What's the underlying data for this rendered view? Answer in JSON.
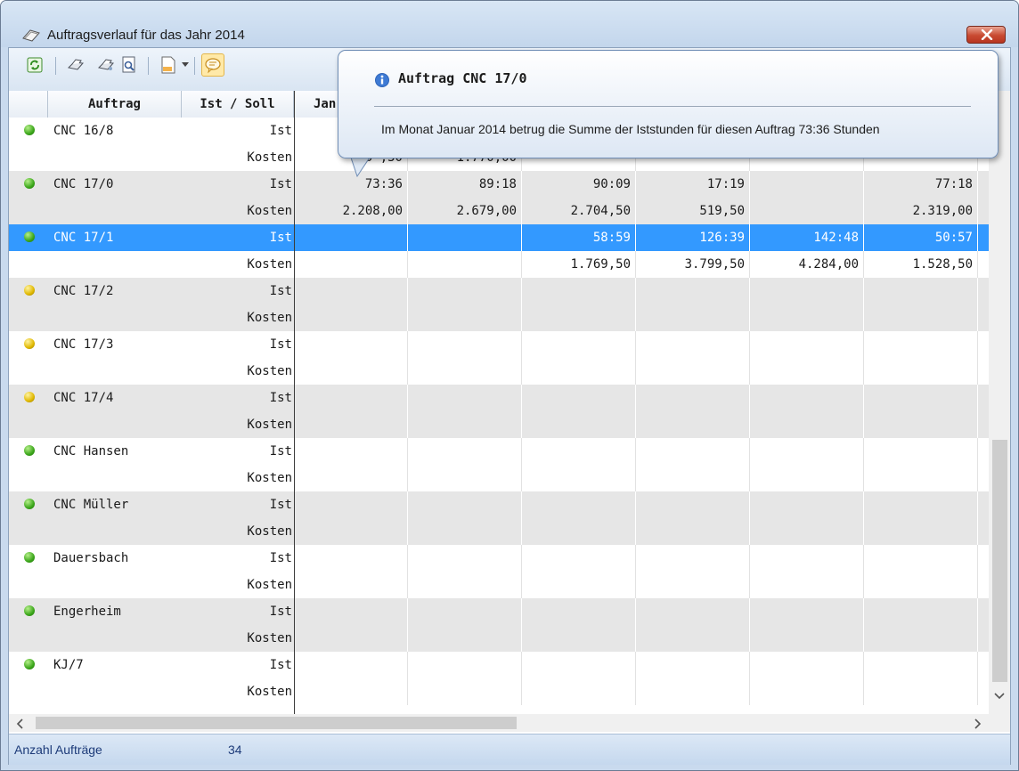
{
  "window": {
    "title": "Auftragsverlauf für das Jahr 2014"
  },
  "grid": {
    "headers": {
      "order": "Auftrag",
      "type": "Ist / Soll",
      "month1": "Jan"
    },
    "rows": [
      {
        "order": "CNC 16/8",
        "status": "green",
        "ist": "Ist",
        "kosten": "Kosten",
        "ist_vals": [
          "",
          "",
          "",
          "",
          "",
          ""
        ],
        "kosten_vals": [
          "1.0  ,50",
          "1.770,00",
          "",
          "",
          "",
          ""
        ]
      },
      {
        "order": "CNC 17/0",
        "status": "green",
        "ist": "Ist",
        "kosten": "Kosten",
        "ist_vals": [
          "73:36",
          "89:18",
          "90:09",
          "17:19",
          "",
          "77:18"
        ],
        "kosten_vals": [
          "2.208,00",
          "2.679,00",
          "2.704,50",
          "519,50",
          "",
          "2.319,00"
        ]
      },
      {
        "order": "CNC 17/1",
        "status": "green",
        "ist": "Ist",
        "kosten": "Kosten",
        "ist_vals": [
          "",
          "",
          "58:59",
          "126:39",
          "142:48",
          "50:57"
        ],
        "kosten_vals": [
          "",
          "",
          "1.769,50",
          "3.799,50",
          "4.284,00",
          "1.528,50"
        ]
      },
      {
        "order": "CNC 17/2",
        "status": "yellow",
        "ist": "Ist",
        "kosten": "Kosten",
        "ist_vals": [
          "",
          "",
          "",
          "",
          "",
          ""
        ],
        "kosten_vals": [
          "",
          "",
          "",
          "",
          "",
          ""
        ]
      },
      {
        "order": "CNC 17/3",
        "status": "yellow",
        "ist": "Ist",
        "kosten": "Kosten",
        "ist_vals": [
          "",
          "",
          "",
          "",
          "",
          ""
        ],
        "kosten_vals": [
          "",
          "",
          "",
          "",
          "",
          ""
        ]
      },
      {
        "order": "CNC 17/4",
        "status": "yellow",
        "ist": "Ist",
        "kosten": "Kosten",
        "ist_vals": [
          "",
          "",
          "",
          "",
          "",
          ""
        ],
        "kosten_vals": [
          "",
          "",
          "",
          "",
          "",
          ""
        ]
      },
      {
        "order": "CNC Hansen",
        "status": "green",
        "ist": "Ist",
        "kosten": "Kosten",
        "ist_vals": [
          "",
          "",
          "",
          "",
          "",
          ""
        ],
        "kosten_vals": [
          "",
          "",
          "",
          "",
          "",
          ""
        ]
      },
      {
        "order": "CNC Müller",
        "status": "green",
        "ist": "Ist",
        "kosten": "Kosten",
        "ist_vals": [
          "",
          "",
          "",
          "",
          "",
          ""
        ],
        "kosten_vals": [
          "",
          "",
          "",
          "",
          "",
          ""
        ]
      },
      {
        "order": "Dauersbach",
        "status": "green",
        "ist": "Ist",
        "kosten": "Kosten",
        "ist_vals": [
          "",
          "",
          "",
          "",
          "",
          ""
        ],
        "kosten_vals": [
          "",
          "",
          "",
          "",
          "",
          ""
        ]
      },
      {
        "order": "Engerheim",
        "status": "green",
        "ist": "Ist",
        "kosten": "Kosten",
        "ist_vals": [
          "",
          "",
          "",
          "",
          "",
          ""
        ],
        "kosten_vals": [
          "",
          "",
          "",
          "",
          "",
          ""
        ]
      },
      {
        "order": "KJ/7",
        "status": "green",
        "ist": "Ist",
        "kosten": "Kosten",
        "ist_vals": [
          "",
          "",
          "",
          "",
          "",
          ""
        ],
        "kosten_vals": [
          "",
          "",
          "",
          "",
          "",
          ""
        ]
      }
    ],
    "selected_order": "CNC 17/1"
  },
  "tooltip": {
    "title": "Auftrag CNC 17/0",
    "body": "Im Monat Januar 2014 betrug die Summe der Iststunden für diesen Auftrag 73:36 Stunden"
  },
  "status": {
    "label": "Anzahl Aufträge",
    "value": "34"
  },
  "colors": {
    "selection": "#3399ff",
    "row_alt": "#e6e6e6",
    "status_text": "#1d3b79"
  }
}
